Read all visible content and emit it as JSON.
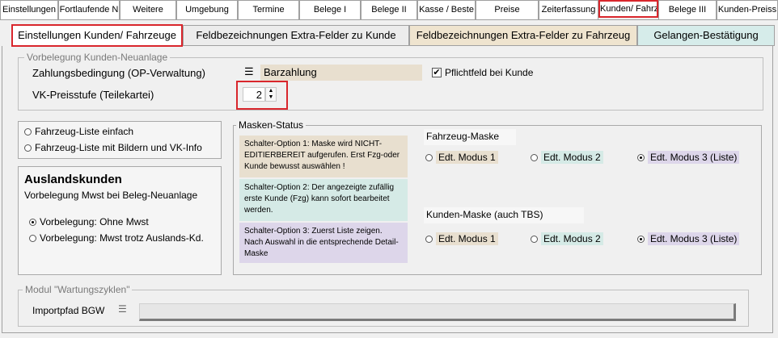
{
  "top_tabs": [
    "Einstellungen",
    "Fortlaufende N",
    "Weitere",
    "Umgebung",
    "Termine",
    "Belege I",
    "Belege II",
    "Kasse / Beste",
    "Preise",
    "Zeiterfassung",
    "Kunden/ Fahrz",
    "Belege III",
    "Kunden-Preiss"
  ],
  "sub_tabs": [
    "Einstellungen Kunden/ Fahrzeuge",
    "Feldbezeichnungen Extra-Felder zu Kunde",
    "Feldbezeichnungen Extra-Felder zu Fahrzeug",
    "Gelangen-Bestätigung"
  ],
  "vorbelegung": {
    "title": "Vorbelegung Kunden-Neuanlage",
    "zahlung_label": "Zahlungsbedingung (OP-Verwaltung)",
    "zahlung_value": "Barzahlung",
    "pflicht_label": "Pflichtfeld bei Kunde",
    "vk_label": "VK-Preisstufe (Teilekartei)",
    "vk_value": "2"
  },
  "fahrzeug_liste": [
    "Fahrzeug-Liste einfach",
    "Fahrzeug-Liste mit Bildern und VK-Info"
  ],
  "ausland": {
    "title": "Auslandskunden",
    "subtitle": "Vorbelegung Mwst bei Beleg-Neuanlage",
    "options": [
      "Vorbelegung: Ohne Mwst",
      "Vorbelegung: Mwst trotz Auslands-Kd."
    ]
  },
  "masken": {
    "title": "Masken-Status",
    "note1": "Schalter-Option 1: Maske wird NICHT-EDITIERBEREIT aufgerufen. Erst Fzg-oder Kunde bewusst auswählen !",
    "note2": "Schalter-Option 2: Der angezeigte zufällig erste Kunde (Fzg) kann sofort bearbeitet werden.",
    "note3": "Schalter-Option 3: Zuerst Liste zeigen. Nach Auswahl in die entsprechende Detail-Maske",
    "fahrzeug_title": "Fahrzeug-Maske",
    "kunden_title": "Kunden-Maske (auch TBS)",
    "modes": [
      "Edt. Modus 1",
      "Edt. Modus 2",
      "Edt. Modus 3 (Liste)"
    ]
  },
  "wartung": {
    "title": "Modul \"Wartungszyklen\"",
    "import_label": "Importpfad BGW"
  },
  "colors": {
    "accent_red": "#d9262c",
    "beige": "#e8dfcf",
    "mint": "#d5eae6",
    "lavender": "#ddd6ea"
  }
}
